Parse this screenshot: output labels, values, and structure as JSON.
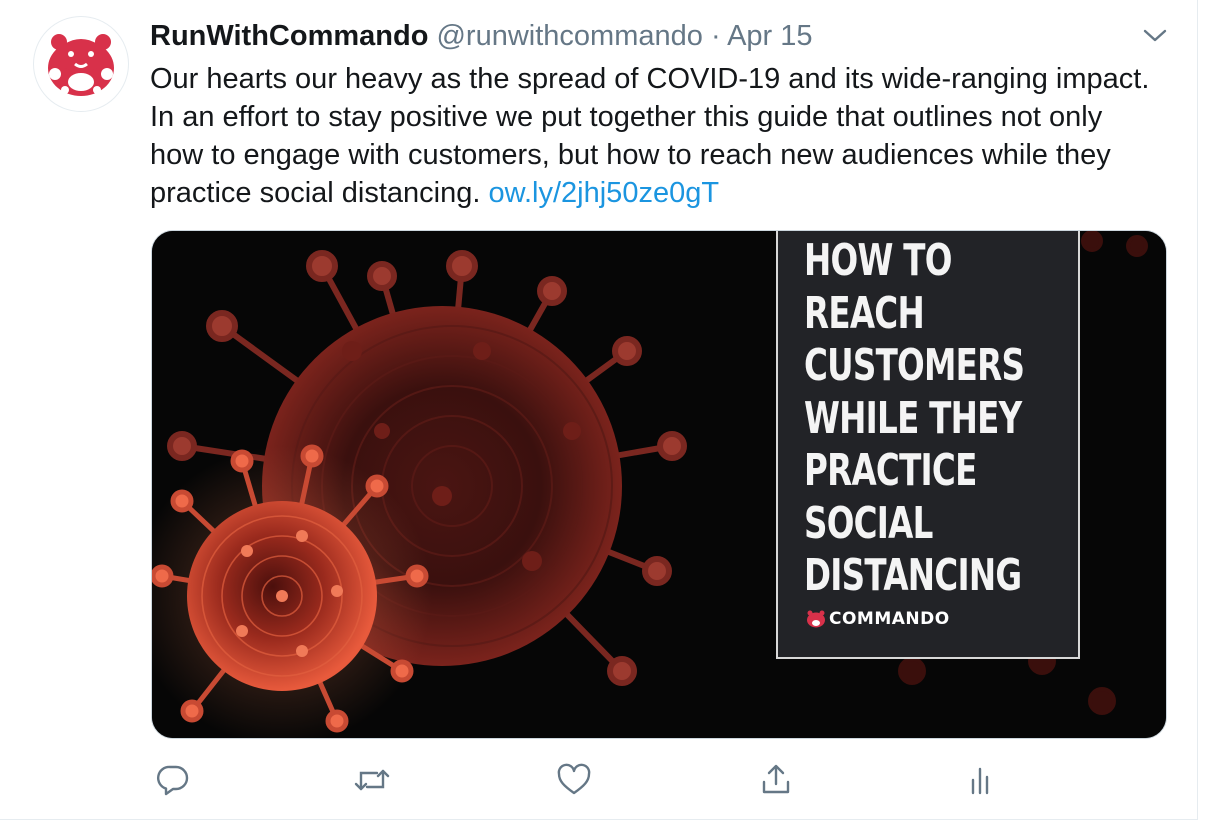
{
  "tweet": {
    "author_name": "RunWithCommando",
    "author_handle": "@runwithcommando",
    "separator": "·",
    "date": "Apr 15",
    "text": "Our hearts our heavy as the spread of COVID-19 and its wide-ranging impact. In an effort to stay positive we put together this guide that outlines not only how to engage with customers, but how to reach new audiences while they practice social distancing.",
    "link_text": "ow.ly/2jhj50ze0gT"
  },
  "media": {
    "cover_title_lines": [
      "HOW TO",
      "REACH",
      "CUSTOMERS",
      "WHILE THEY",
      "PRACTICE",
      "SOCIAL",
      "DISTANCING"
    ],
    "cover_brand": "COMMANDO"
  },
  "actions": [
    "reply-icon",
    "retweet-icon",
    "like-icon",
    "share-icon",
    "analytics-icon"
  ],
  "colors": {
    "link": "#1b95e0",
    "secondary_text": "#657786",
    "icon": "#657786",
    "brand_red": "#d8314a"
  }
}
